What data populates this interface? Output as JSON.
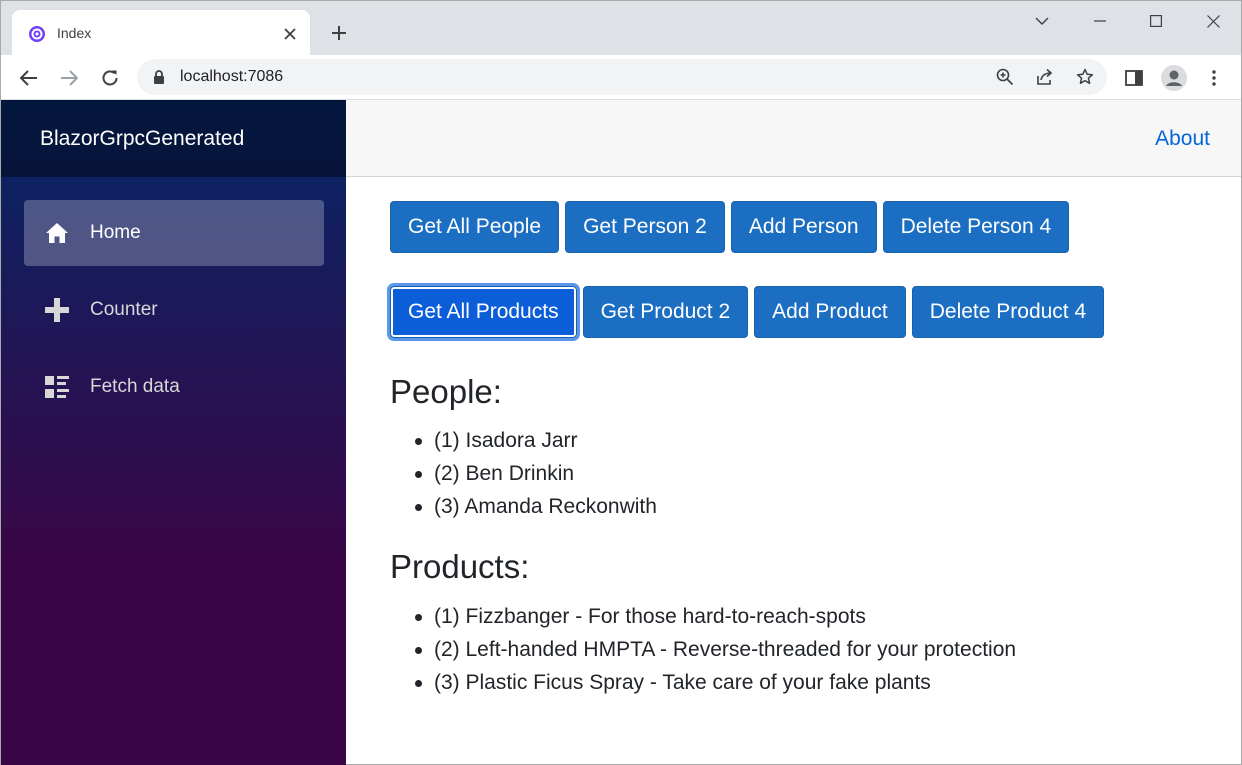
{
  "browser": {
    "tab_title": "Index",
    "url": "localhost:7086"
  },
  "app": {
    "brand": "BlazorGrpcGenerated",
    "about_link": "About",
    "nav": [
      {
        "label": "Home",
        "icon": "home-icon",
        "active": true
      },
      {
        "label": "Counter",
        "icon": "plus-icon",
        "active": false
      },
      {
        "label": "Fetch data",
        "icon": "list-rich-icon",
        "active": false
      }
    ]
  },
  "buttons": {
    "people": [
      "Get All People",
      "Get Person 2",
      "Add Person",
      "Delete Person 4"
    ],
    "products": [
      "Get All Products",
      "Get Product 2",
      "Add Product",
      "Delete Product 4"
    ]
  },
  "people": {
    "heading": "People:",
    "items": [
      "(1) Isadora Jarr",
      "(2) Ben Drinkin",
      "(3) Amanda Reckonwith"
    ]
  },
  "products": {
    "heading": "Products:",
    "items": [
      "(1) Fizzbanger - For those hard-to-reach-spots",
      "(2) Left-handed HMPTA - Reverse-threaded for your protection",
      "(3) Plastic Ficus Spray - Take care of your fake plants"
    ]
  },
  "colors": {
    "button": "#1b6ec2",
    "link": "#0366d6",
    "sidebar_top": "#052767",
    "sidebar_bottom": "#3a0647"
  }
}
